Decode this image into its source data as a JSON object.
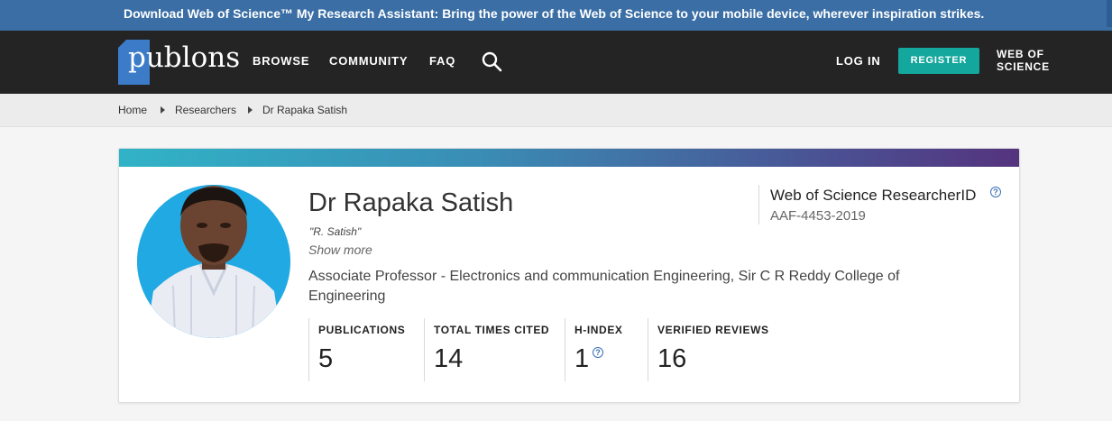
{
  "banner": {
    "text": "Download Web of Science™ My Research Assistant: Bring the power of the Web of Science to your mobile device, wherever inspiration strikes."
  },
  "nav": {
    "logo": "publons",
    "browse": "BROWSE",
    "community": "COMMUNITY",
    "faq": "FAQ",
    "search_icon": "search-icon",
    "login": "LOG IN",
    "register": "REGISTER",
    "wos_line1": "WEB OF",
    "wos_line2": "SCIENCE"
  },
  "breadcrumb": {
    "home": "Home",
    "researchers": "Researchers",
    "current": "Dr Rapaka Satish"
  },
  "profile": {
    "name": "Dr Rapaka Satish",
    "alias": "\"R. Satish\"",
    "show_more": "Show more",
    "affiliation": "Associate Professor - Electronics and communication Engineering, Sir C R Reddy College of Engineering",
    "researcher_id_title": "Web of Science ResearcherID",
    "researcher_id": "AAF-4453-2019"
  },
  "metrics": {
    "publications_label": "PUBLICATIONS",
    "publications_value": "5",
    "cited_label": "TOTAL TIMES CITED",
    "cited_value": "14",
    "hindex_label": "H-INDEX",
    "hindex_value": "1",
    "reviews_label": "VERIFIED REVIEWS",
    "reviews_value": "16"
  },
  "colors": {
    "banner": "#3a6ea5",
    "navbar": "#242424",
    "register": "#14a79d",
    "logo_block": "#3b7bc8",
    "avatar_bg": "#21a9e3"
  }
}
